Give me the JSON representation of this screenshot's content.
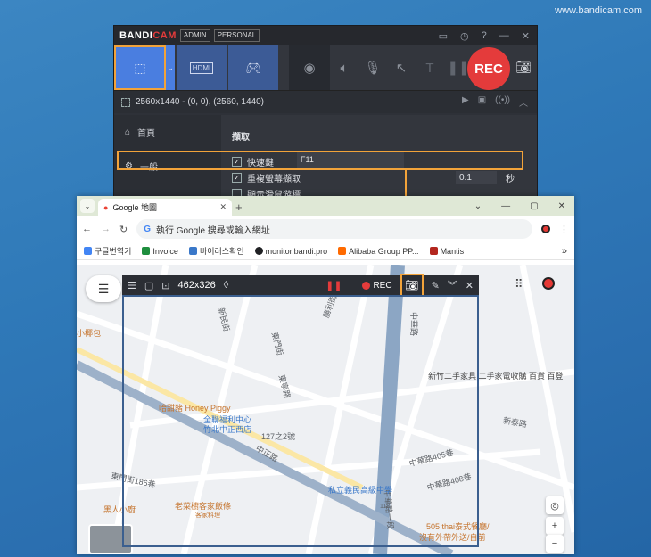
{
  "watermark": "www.bandicam.com",
  "bandicam": {
    "logo_a": "BANDI",
    "logo_b": "CAM",
    "tag_admin": "ADMIN",
    "tag_personal": "PERSONAL",
    "title_icons": [
      "folder-icon",
      "clock-icon",
      "help-icon",
      "minimize-icon",
      "close-icon"
    ],
    "modes": {
      "screen": "screen-rect-mode",
      "hdmi": "HDMI",
      "game": "game-mode"
    },
    "rec_label": "REC",
    "area_text": "2560x1440 - (0, 0), (2560, 1440)",
    "sidebar": [
      {
        "icon": "⌂",
        "label": "首頁"
      },
      {
        "icon": "⚙",
        "label": "一般"
      }
    ],
    "section_title": "擷取",
    "rows": [
      {
        "label": "快速鍵",
        "checked": true,
        "value": "F11"
      },
      {
        "label": "重複螢幕擷取",
        "checked": true,
        "value": "0.1",
        "unit": "秒"
      },
      {
        "label": "顯示滑鼠游標",
        "checked": false
      }
    ]
  },
  "browser": {
    "tab_title": "Google 地圖",
    "omnibox_placeholder": "執行 Google 搜尋或輸入網址",
    "bookmarks": [
      {
        "label": "구글번역기",
        "color": "#4285f4"
      },
      {
        "label": "Invoice",
        "color": "#1e8e3e"
      },
      {
        "label": "바이러스확인",
        "color": "#3a78c9"
      },
      {
        "label": "monitor.bandi.pro",
        "color": "#202124"
      },
      {
        "label": "Alibaba Group PP...",
        "color": "#ff6a00"
      },
      {
        "label": "Mantis",
        "color": "#b3261e"
      }
    ]
  },
  "map": {
    "labels": [
      "新民街",
      "東門街",
      "勝利街",
      "東寧路",
      "中華路",
      "中正路",
      "中華路一段",
      "中華路405巷",
      "中華路408巷",
      "東門街186巷",
      "新泰路",
      "127之2號",
      "118"
    ],
    "pois": [
      "哈甜豬 Honey Piggy",
      "黑人小廚",
      "老菜櫥客家飯條",
      "客家料理",
      "505 thai泰式餐廳/",
      "沒有外帶外送/自前",
      "小椰包"
    ],
    "pois_blue": [
      "全聯福利中心",
      "竹北中正西店",
      "私立義民高級中學"
    ],
    "right_labels": [
      "新竹二手家具 二手家電收購 百貨 百登"
    ]
  },
  "overlay": {
    "size_text": "462x326",
    "rec_label": "REC"
  }
}
